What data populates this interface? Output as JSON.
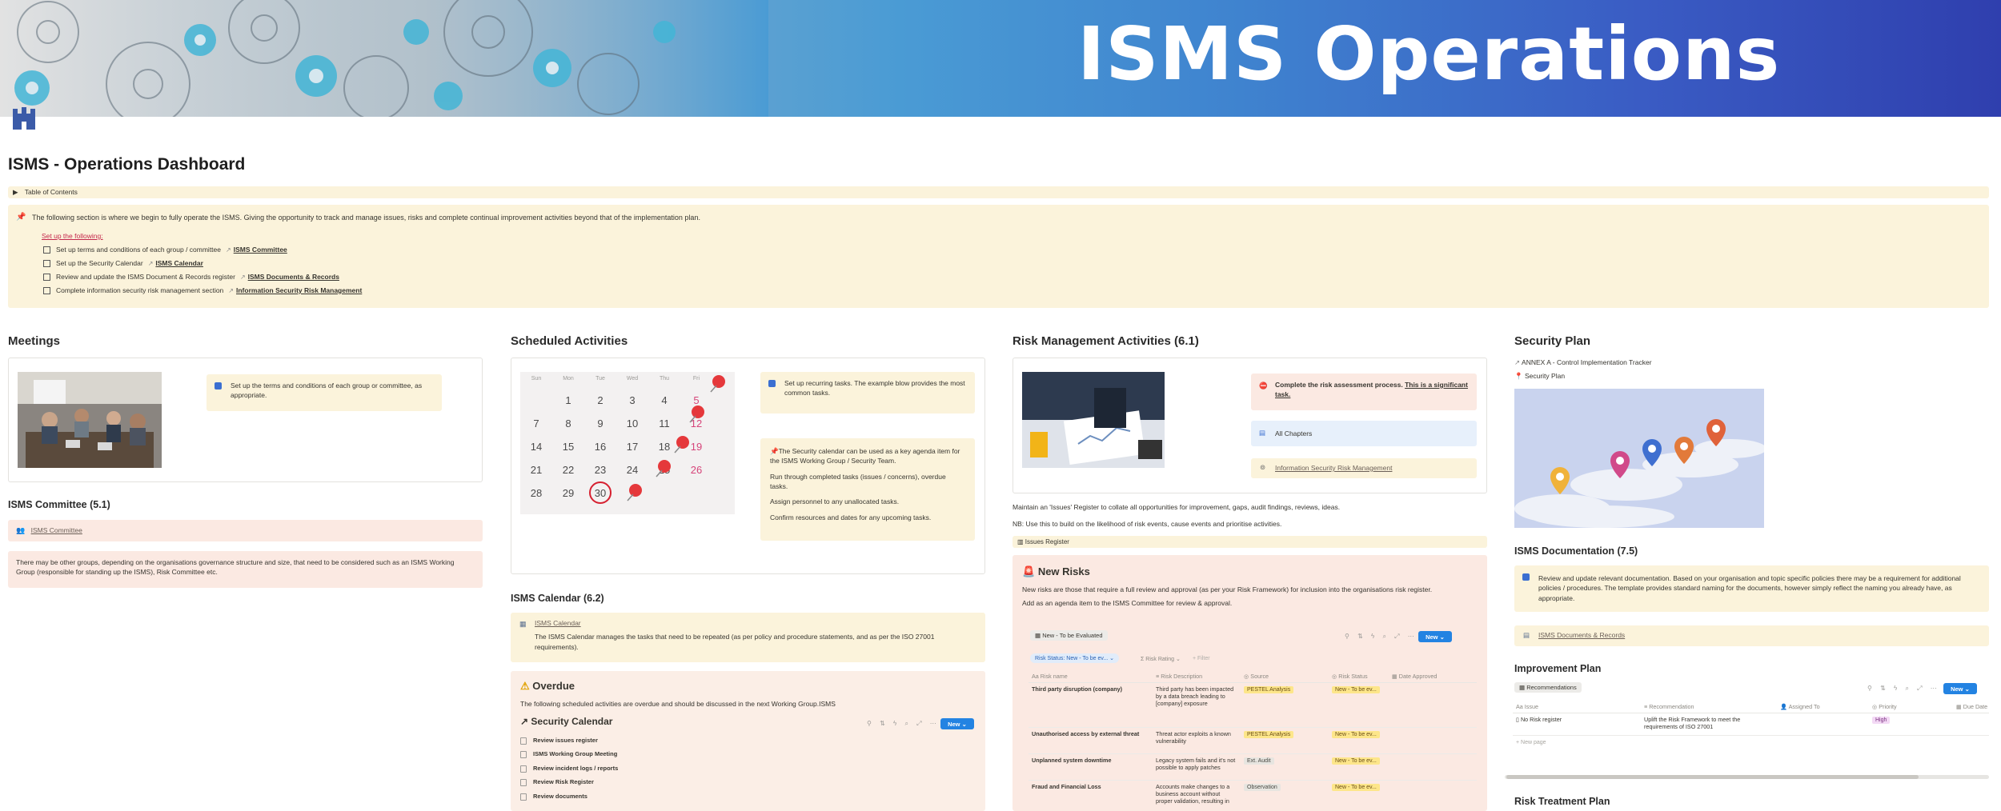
{
  "banner": {
    "title": "ISMS Operations"
  },
  "page": {
    "title": "ISMS - Operations Dashboard"
  },
  "toc": {
    "label": "Table of Contents"
  },
  "intro": {
    "text": "The following section is where we begin to fully operate the ISMS.  Giving the opportunity to track and manage issues, risks and complete continual improvement activities beyond that of the implementation plan.",
    "setup_label": "Set up the following:",
    "todos": [
      {
        "text": "Set up terms and conditions of each group / committee",
        "link": "ISMS Committee"
      },
      {
        "text": "Set up the Security Calendar",
        "link": "ISMS Calendar"
      },
      {
        "text": "Review and update the ISMS Document & Records register",
        "link": "ISMS Documents & Records"
      },
      {
        "text": "Complete information security risk management section",
        "link": "Information Security Risk Management"
      }
    ]
  },
  "meetings": {
    "title": "Meetings",
    "callout": "Set up the terms and conditions of each group or committee, as appropriate.",
    "committee_title": "ISMS Committee (5.1)",
    "committee_link": "ISMS Committee",
    "note": "There may be other groups, depending on the organisations governance structure and size, that need to be considered such as an ISMS Working Group (responsible for standing up the ISMS), Risk Committee etc."
  },
  "scheduled": {
    "title": "Scheduled Activities",
    "calendar": {
      "days": [
        "Sun",
        "Mon",
        "Tue",
        "Wed",
        "Thu",
        "Fri"
      ],
      "rows": [
        [
          "",
          "1",
          "2",
          "3",
          "4",
          "5"
        ],
        [
          "7",
          "8",
          "9",
          "10",
          "11",
          "12"
        ],
        [
          "14",
          "15",
          "16",
          "17",
          "18",
          "19"
        ],
        [
          "21",
          "22",
          "23",
          "24",
          "25",
          "26"
        ],
        [
          "28",
          "29",
          "30",
          "",
          "",
          ""
        ]
      ]
    },
    "callout1": "Set up recurring tasks.  The example blow provides the most common tasks.",
    "callout2": {
      "p1": "The Security calendar can be used as a key agenda item for the ISMS Working Group / Security Team.",
      "p2": "Run through completed tasks (issues / concerns), overdue tasks.",
      "p3": "Assign personnel to any unallocated tasks.",
      "p4": "Confirm resources and dates for any upcoming tasks."
    },
    "cal_title": "ISMS Calendar (6.2)",
    "cal_link": "ISMS Calendar",
    "cal_desc": "The ISMS Calendar manages the tasks that need to be repeated (as per policy and procedure statements, and as per the ISO 27001 requirements).",
    "overdue_title": "Overdue",
    "overdue_desc": "The following scheduled activities are overdue and should be discussed in the next Working Group.ISMS",
    "db_title": "Security Calendar",
    "new_label": "New",
    "items": [
      "Review issues register",
      "ISMS Working Group Meeting",
      "Review incident logs / reports",
      "Review Risk Register",
      "Review documents"
    ]
  },
  "risk": {
    "title": "Risk Management Activities (6.1)",
    "callout_main": "Complete the risk assessment process.",
    "callout_link": "This is a significant task.",
    "chapters": "All Chapters",
    "rm_link": "Information Security Risk Management",
    "p1": "Maintain an 'Issues' Register to collate all opportunities for improvement, gaps, audit findings, reviews, ideas.",
    "p2": "NB: Use this to build on the likelihood of risk events, cause events and prioritise activities.",
    "issues_toggle": "Issues Register",
    "new_risks_title": "New Risks",
    "new_risks_desc1": "New risks are those that require a full review and approval (as per your Risk Framework) for inclusion into the organisations risk register.",
    "new_risks_desc2": "Add as an agenda item to the ISMS Committee for review & approval.",
    "view_tab": "New - To be Evaluated",
    "filter1": "Risk Status: New - To be ev...",
    "filter2": "Risk Rating",
    "filter3": "+ Filter",
    "new_label": "New",
    "columns": [
      "Risk name",
      "Risk Description",
      "Source",
      "Risk Status",
      "Date Approved"
    ],
    "rows": [
      {
        "name": "Third party disruption (company)",
        "desc": "Third party has been impacted by a data breach leading to [company] exposure",
        "source": "PESTEL Analysis",
        "status": "New - To be ev..."
      },
      {
        "name": "Unauthorised access by external threat",
        "desc": "Threat actor exploits a known vulnerability",
        "source": "PESTEL Analysis",
        "status": "New - To be ev..."
      },
      {
        "name": "Unplanned system downtime",
        "desc": "Legacy system fails and it's not possible to apply patches",
        "source": "Ext. Audit",
        "status": "New - To be ev..."
      },
      {
        "name": "Fraud and Financial Loss",
        "desc": "Accounts make changes to a business account without proper validation, resulting in",
        "source": "Observation",
        "status": "New - To be ev..."
      }
    ]
  },
  "security_plan": {
    "title": "Security Plan",
    "link1": "ANNEX A - Control Implementation Tracker",
    "link2": "Security Plan",
    "doc_title": "ISMS Documentation (7.5)",
    "doc_callout": "Review and update relevant documentation.  Based on your organisation and topic specific policies there may be a requirement for additional policies / procedures.  The template provides standard naming for the documents, however simply reflect the naming you already have, as appropriate.",
    "doc_link": "ISMS Documents & Records",
    "improve_title": "Improvement Plan",
    "improve_tab": "Recommendations",
    "new_label": "New",
    "columns": [
      "Issue",
      "Recommendation",
      "Assigned To",
      "Priority",
      "Due Date"
    ],
    "rows": [
      {
        "issue": "No Risk register",
        "rec": "Uplift the Risk Framework to meet the requirements of ISO 27001",
        "assigned": "",
        "priority": "High",
        "due": ""
      }
    ],
    "new_page": "+ New page",
    "treatment_title": "Risk Treatment Plan"
  },
  "colors": {
    "accent": "#2383e2",
    "callout_yellow": "#fbf3db",
    "callout_pink": "#fbe9e2",
    "callout_blue": "#e7f0fb"
  }
}
